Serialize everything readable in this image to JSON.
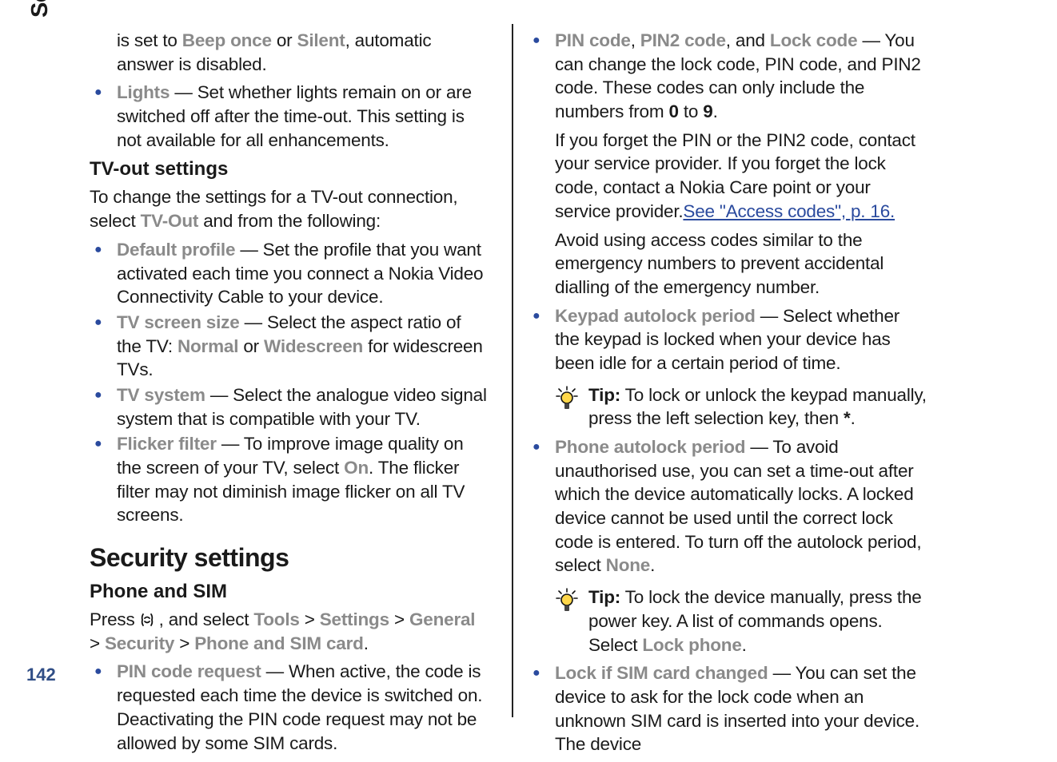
{
  "tab": "Settings",
  "page_number": "142",
  "col1": {
    "p1a": "is set to ",
    "p1_beep": "Beep once",
    "p1b": " or ",
    "p1_silent": "Silent",
    "p1c": ", automatic answer is disabled.",
    "li_lights_label": "Lights",
    "li_lights_text": "  — Set whether lights remain on or are switched off after the time-out. This setting is not available for all enhancements.",
    "tvout_heading": "TV-out settings",
    "tvout_intro_a": "To change the settings for a TV-out connection, select ",
    "tvout_intro_b": "TV-Out",
    "tvout_intro_c": " and from the following:",
    "li_default_label": "Default profile",
    "li_default_text": "  — Set the profile that you want activated each time you connect a Nokia Video Connectivity Cable to your device.",
    "li_screensize_label": "TV screen size",
    "li_screensize_a": "  — Select the aspect ratio of the TV: ",
    "li_screensize_normal": "Normal",
    "li_screensize_b": " or ",
    "li_screensize_wide": "Widescreen",
    "li_screensize_c": " for widescreen TVs.",
    "li_tvsystem_label": "TV system",
    "li_tvsystem_text": "  — Select the analogue video signal system that is compatible with your TV.",
    "li_flicker_label": "Flicker filter",
    "li_flicker_a": "  — To improve image quality on the screen of your TV, select ",
    "li_flicker_on": "On",
    "li_flicker_b": ". The flicker filter may not diminish image flicker on all TV screens.",
    "security_heading": "Security settings",
    "phonesim_heading": "Phone and SIM",
    "press_a": "Press  ",
    "press_b": " , and select ",
    "press_tools": "Tools",
    "press_gt1": "  >  ",
    "press_settings": "Settings",
    "press_gt2": "  > ",
    "press_general": "General",
    "press_gt3": "  >  ",
    "press_security": "Security",
    "press_gt4": "  >  ",
    "press_phonesim": "Phone and SIM card",
    "press_dot": ".",
    "li_pinreq_label": "PIN code request",
    "li_pinreq_text": " — When active, the code is requested each time the device is switched on. Deactivating the PIN code request may not be allowed by some SIM cards."
  },
  "col2": {
    "li_codes_pin": "PIN code",
    "li_codes_sep1": ", ",
    "li_codes_pin2": "PIN2 code",
    "li_codes_sep2": ", and ",
    "li_codes_lock": "Lock code",
    "li_codes_a": " — You can change the lock code, PIN code, and PIN2 code. These codes can only include the numbers from ",
    "li_codes_0": "0",
    "li_codes_b": " to ",
    "li_codes_9": "9",
    "li_codes_c": ".",
    "forget_a": "If you forget the PIN or the PIN2 code, contact your service provider. If you forget the lock code, contact a Nokia Care point or your service provider.",
    "forget_link": "See \"Access codes\", p. 16.",
    "avoid": "Avoid using access codes similar to the emergency numbers to prevent accidental dialling of the emergency number.",
    "li_keypad_label": "Keypad autolock period",
    "li_keypad_text": " — Select whether the keypad is locked when your device has been idle for a certain period of time.",
    "tip1_label": "Tip:",
    "tip1_text": " To lock or unlock the keypad manually, press the left selection key, then ",
    "tip1_star": "*",
    "tip1_dot": ".",
    "li_phoneauto_label": "Phone autolock period",
    "li_phoneauto_a": " — To avoid unauthorised use, you can set a time-out after which the device automatically locks. A locked device cannot be used until the correct lock code is entered. To turn off the autolock period, select ",
    "li_phoneauto_none": "None",
    "li_phoneauto_b": ".",
    "tip2_label": "Tip:",
    "tip2_a": " To lock the device manually, press the power key. A list of commands opens. Select ",
    "tip2_lockphone": "Lock phone",
    "tip2_b": ".",
    "li_locksim_label": "Lock if SIM card changed",
    "li_locksim_text": " — You can set the device to ask for the lock code when an unknown SIM card is inserted into your device. The device"
  }
}
